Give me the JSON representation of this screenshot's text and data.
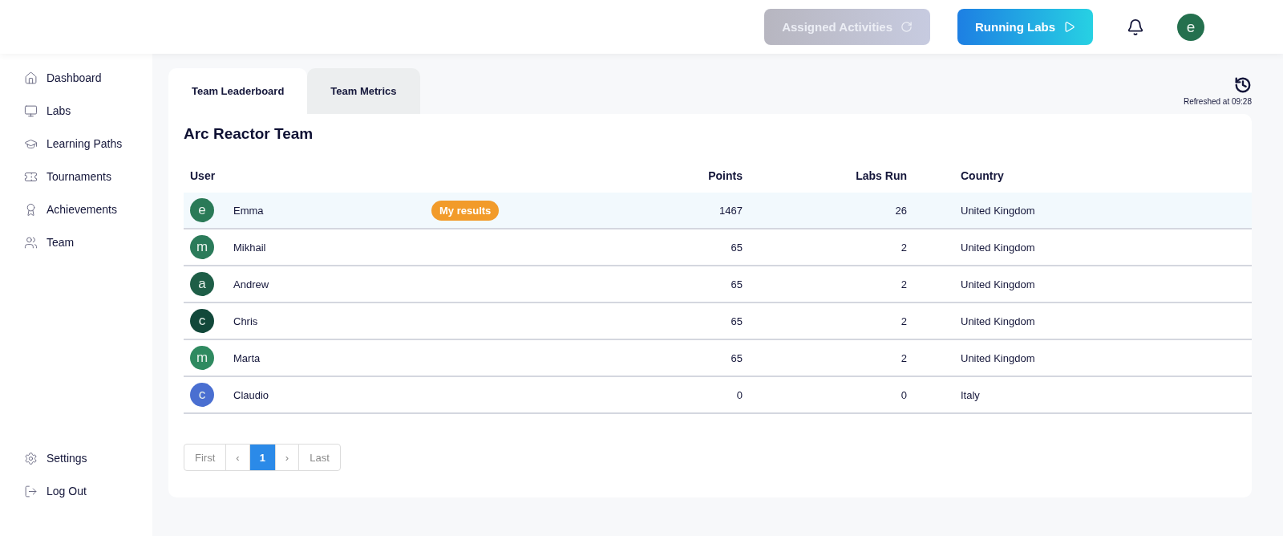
{
  "header": {
    "buttons": [
      {
        "label": "Assigned Activities",
        "disabled": true,
        "kind": "assigned"
      },
      {
        "label": "Running Labs",
        "disabled": false,
        "kind": "running"
      }
    ],
    "avatar": "e"
  },
  "sidebar": {
    "items": [
      {
        "label": "Dashboard",
        "selected": false
      },
      {
        "label": "Labs",
        "selected": false
      },
      {
        "label": "Learning Paths",
        "selected": false
      },
      {
        "label": "Tournaments",
        "selected": false
      },
      {
        "label": "Achievements",
        "selected": false
      },
      {
        "label": "Team",
        "selected": false
      }
    ],
    "bottom_items": [
      {
        "label": "Settings"
      },
      {
        "label": "Log Out"
      }
    ]
  },
  "tabs": [
    {
      "label": "Team Leaderboard",
      "selected": true
    },
    {
      "label": "Team Metrics",
      "selected": false
    }
  ],
  "refreshed": "Refreshed at 09:28",
  "title": "Arc Reactor Team",
  "table": {
    "columns": [
      "User",
      "Points",
      "Labs Run",
      "Country"
    ],
    "rows": [
      {
        "initial": "e",
        "color": "#2a7a57",
        "name": "Emma",
        "badge": "My results",
        "points": "1467",
        "labs_run": "26",
        "country": "United Kingdom",
        "selected": true
      },
      {
        "initial": "m",
        "color": "#2b7b5a",
        "name": "Mikhail",
        "points": "65",
        "labs_run": "2",
        "country": "United Kingdom",
        "selected": false
      },
      {
        "initial": "a",
        "color": "#1e5e47",
        "name": "Andrew",
        "points": "65",
        "labs_run": "2",
        "country": "United Kingdom",
        "selected": false
      },
      {
        "initial": "c",
        "color": "#12483a",
        "name": "Chris",
        "points": "65",
        "labs_run": "2",
        "country": "United Kingdom",
        "selected": false
      },
      {
        "initial": "m",
        "color": "#2f8a60",
        "name": "Marta",
        "points": "65",
        "labs_run": "2",
        "country": "United Kingdom",
        "selected": false
      },
      {
        "initial": "c",
        "color": "#4a6fd1",
        "name": "Claudio",
        "points": "0",
        "labs_run": "0",
        "country": "Italy",
        "selected": false
      }
    ]
  },
  "pagination": [
    {
      "label": "First",
      "selected": false
    },
    {
      "label": "‹",
      "selected": false
    },
    {
      "label": "1",
      "selected": true
    },
    {
      "label": "›",
      "selected": false
    },
    {
      "label": "Last",
      "selected": false
    }
  ]
}
